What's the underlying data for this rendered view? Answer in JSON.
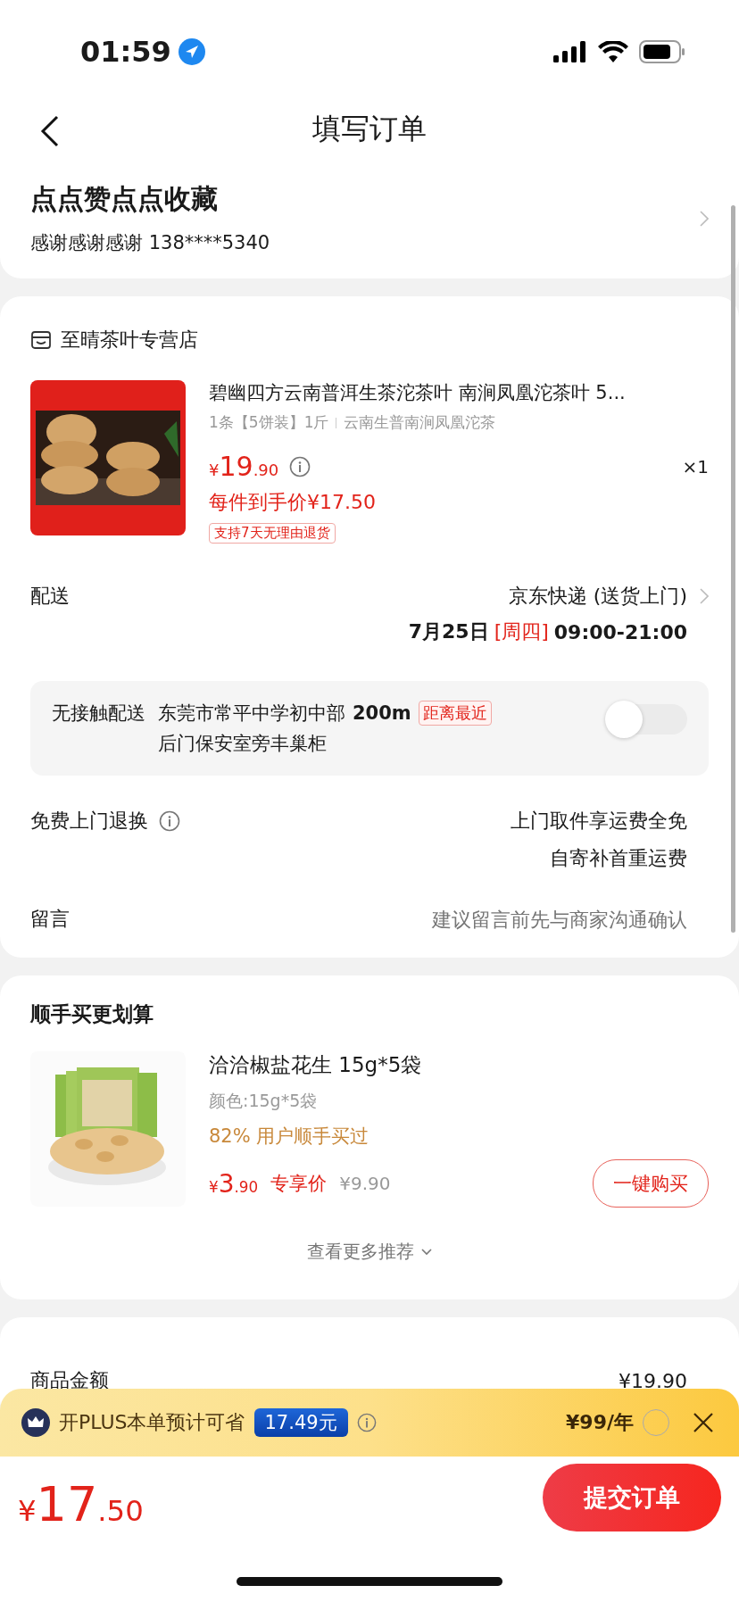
{
  "status_bar": {
    "time": "01:59"
  },
  "header": {
    "title": "填写订单"
  },
  "address": {
    "name": "点点赞点点收藏",
    "contact": "感谢感谢感谢  138****5340"
  },
  "store": {
    "name": "至晴茶叶专营店"
  },
  "product": {
    "title": "碧幽四方云南普洱生茶沱茶叶 南涧凤凰沱茶叶 5...",
    "spec": "1条【5饼装】1斤",
    "variant": "云南生普南涧凤凰沱茶",
    "price_symbol": "¥",
    "price_int": "19",
    "price_dec": ".90",
    "quantity": "×1",
    "final_price": "每件到手价¥17.50",
    "tag": "支持7天无理由退货"
  },
  "delivery": {
    "label": "配送",
    "carrier": "京东快递 (送货上门)",
    "date": "7月25日",
    "weekday": "[周四]",
    "time": "09:00-21:00"
  },
  "contactless": {
    "label": "无接触配送",
    "place": "东莞市常平中学初中部",
    "distance": "200m",
    "badge": "距离最近",
    "detail": "后门保安室旁丰巢柜",
    "on": false
  },
  "returns": {
    "label": "免费上门退换",
    "line1": "上门取件享运费全免",
    "line2": "自寄补首重运费"
  },
  "message": {
    "label": "留言",
    "placeholder": "建议留言前先与商家沟通确认"
  },
  "recommend": {
    "title": "顺手买更划算",
    "item": {
      "name": "洽洽椒盐花生 15g*5袋",
      "variant": "颜色:15g*5袋",
      "bought": "82% 用户顺手买过",
      "price_symbol": "¥",
      "price_int": "3",
      "price_dec": ".90",
      "price_label": "专享价",
      "original": "¥9.90",
      "button": "一键购买"
    },
    "more": "查看更多推荐"
  },
  "summary": {
    "label": "商品金额",
    "value": "¥19.90"
  },
  "plus": {
    "text": "开PLUS本单预计可省",
    "saving": "17.49元",
    "price": "¥99/年",
    "checked": false
  },
  "footer": {
    "price_symbol": "¥",
    "price_int": "17",
    "price_dec": ".50",
    "submit": "提交订单"
  }
}
